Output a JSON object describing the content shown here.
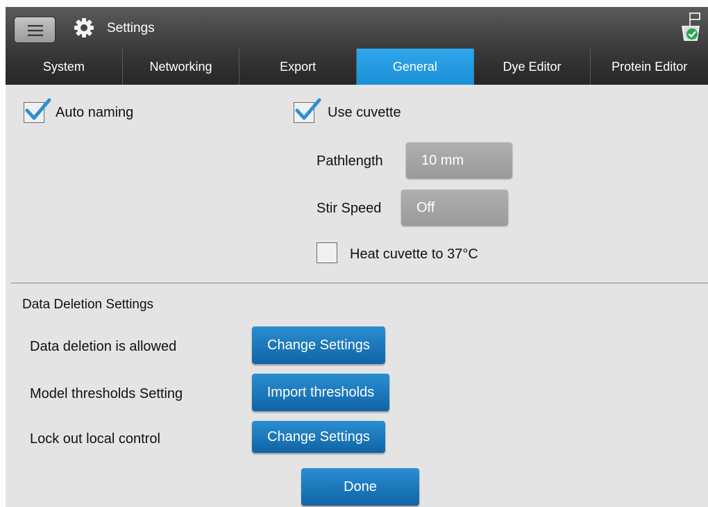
{
  "app": {
    "title": "Settings"
  },
  "tabs": [
    {
      "label": "System",
      "active": false
    },
    {
      "label": "Networking",
      "active": false
    },
    {
      "label": "Export",
      "active": false
    },
    {
      "label": "General",
      "active": true
    },
    {
      "label": "Dye Editor",
      "active": false
    },
    {
      "label": "Protein Editor",
      "active": false
    }
  ],
  "general": {
    "auto_naming": {
      "label": "Auto naming",
      "checked": true
    },
    "use_cuvette": {
      "label": "Use cuvette",
      "checked": true
    },
    "pathlength": {
      "label": "Pathlength",
      "value": "10 mm"
    },
    "stir_speed": {
      "label": "Stir Speed",
      "value": "Off"
    },
    "heat_cuvette": {
      "label": "Heat cuvette to 37°C",
      "checked": false
    }
  },
  "data_deletion": {
    "heading": "Data Deletion Settings",
    "rows": [
      {
        "label": "Data deletion is allowed",
        "button": "Change Settings"
      },
      {
        "label": "Model thresholds Setting",
        "button": "Import thresholds"
      },
      {
        "label": "Lock out local control",
        "button": "Change Settings"
      }
    ]
  },
  "done_label": "Done",
  "colors": {
    "accent": "#1b8fd6",
    "button_blue": "#1770b4",
    "titlebar": "#474747",
    "background": "#e4e4e4"
  },
  "icons": [
    "menu-icon",
    "gear-icon",
    "instrument-status-icon",
    "checkmark-icon"
  ]
}
